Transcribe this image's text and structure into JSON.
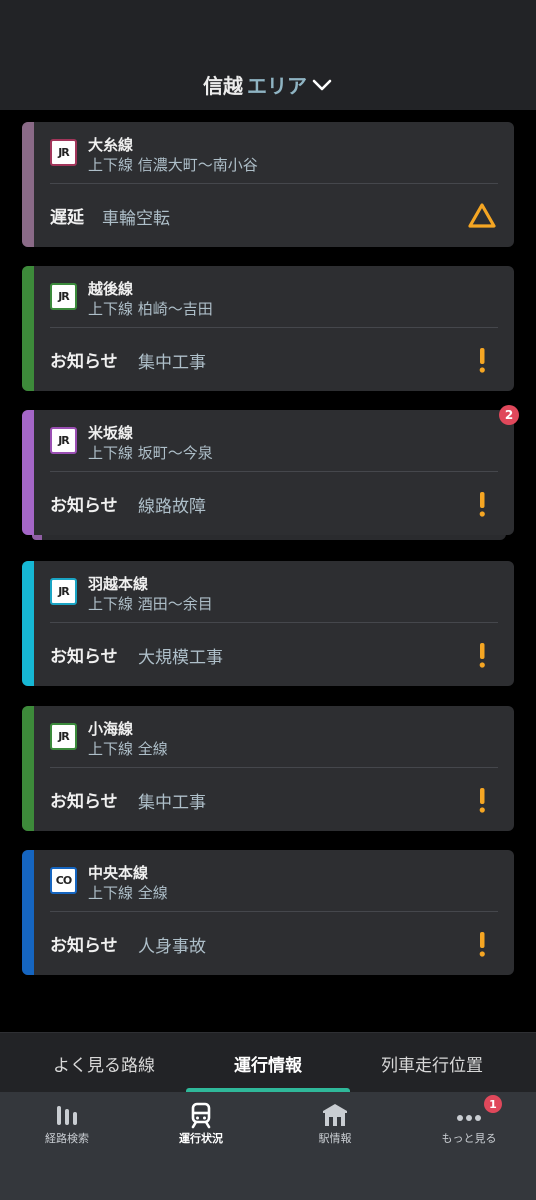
{
  "header": {
    "region": "信越",
    "suffix": "エリア"
  },
  "cards": [
    {
      "logo": "JR",
      "line": "大糸線",
      "section": "上下線 信濃大町〜南小谷",
      "status": "遅延",
      "detail": "車輪空転",
      "icon": "warning-triangle-icon",
      "stripe": "#8a6a87",
      "logo_border": "#a2355a"
    },
    {
      "logo": "JR",
      "line": "越後線",
      "section": "上下線 柏崎〜吉田",
      "status": "お知らせ",
      "detail": "集中工事",
      "icon": "exclamation-icon",
      "stripe": "#3d8a3a",
      "logo_border": "#3b8a3b"
    },
    {
      "logo": "JR",
      "line": "米坂線",
      "section": "上下線 坂町〜今泉",
      "status": "お知らせ",
      "detail": "線路故障",
      "icon": "exclamation-icon",
      "stripe": "#a466c7",
      "logo_border": "#9a4fb3",
      "badge": "2"
    },
    {
      "logo": "JR",
      "line": "羽越本線",
      "section": "上下線 酒田〜余目",
      "status": "お知らせ",
      "detail": "大規模工事",
      "icon": "exclamation-icon",
      "stripe": "#16b7d4",
      "logo_border": "#1aa4c4"
    },
    {
      "logo": "JR",
      "line": "小海線",
      "section": "上下線 全線",
      "status": "お知らせ",
      "detail": "集中工事",
      "icon": "exclamation-icon",
      "stripe": "#3d8a3a",
      "logo_border": "#3b8a3b"
    },
    {
      "logo": "CO",
      "line": "中央本線",
      "section": "上下線 全線",
      "status": "お知らせ",
      "detail": "人身事故",
      "icon": "exclamation-icon",
      "stripe": "#1565c0",
      "logo_border": "#1565c0"
    }
  ],
  "tabs": [
    {
      "label": "よく見る路線"
    },
    {
      "label": "運行情報",
      "active": true
    },
    {
      "label": "列車走行位置"
    }
  ],
  "nav": [
    {
      "label": "経路検索",
      "icon": "route-search-icon"
    },
    {
      "label": "運行状況",
      "icon": "train-icon",
      "active": true
    },
    {
      "label": "駅情報",
      "icon": "station-icon"
    },
    {
      "label": "もっと見る",
      "icon": "more-icon",
      "badge": "1"
    }
  ],
  "colors": {
    "accent": "#2fb89a",
    "warning": "#f5a623",
    "badge": "#e0485b"
  }
}
